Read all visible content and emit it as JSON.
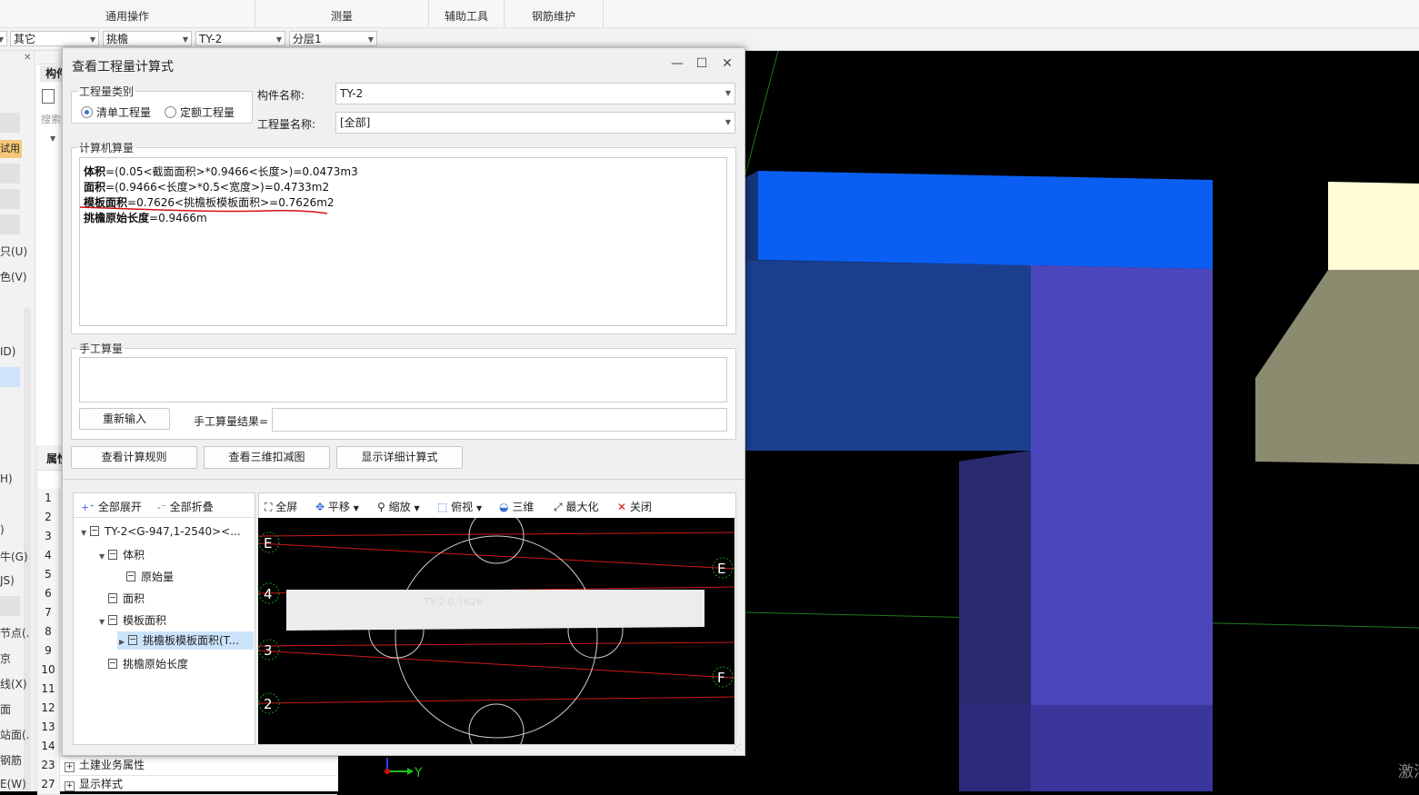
{
  "ribbon": {
    "groups": [
      "通用操作",
      "测量",
      "辅助工具",
      "钢筋维护"
    ]
  },
  "filterbar": {
    "combos": [
      {
        "value": ""
      },
      {
        "value": "其它"
      },
      {
        "value": "挑檐"
      },
      {
        "value": "TY-2"
      },
      {
        "value": "分层1"
      }
    ]
  },
  "left_panel": {
    "header_label": "构件",
    "search_placeholder": "搜索",
    "trial_badge": "试用",
    "strip_texts": [
      "只(U)",
      "色(V)",
      "ID)",
      "H)",
      ")",
      "牛(G)",
      "JS)",
      "节点(.",
      "京",
      "线(X)",
      "面",
      "站面(.",
      "钢筋",
      "E(W)"
    ],
    "prop_header": "属性",
    "prop_rows": [
      {
        "num": "1",
        "label": ""
      },
      {
        "num": "2",
        "label": ""
      },
      {
        "num": "3",
        "label": ""
      },
      {
        "num": "4",
        "label": ""
      },
      {
        "num": "5",
        "label": ""
      },
      {
        "num": "6",
        "label": ""
      },
      {
        "num": "7",
        "label": ""
      },
      {
        "num": "8",
        "label": ""
      },
      {
        "num": "9",
        "label": ""
      },
      {
        "num": "10",
        "label": ""
      },
      {
        "num": "11",
        "label": ""
      },
      {
        "num": "12",
        "label": ""
      },
      {
        "num": "13",
        "label": ""
      },
      {
        "num": "14",
        "label": ""
      },
      {
        "num": "23",
        "label": "土建业务属性"
      },
      {
        "num": "27",
        "label": "显示样式"
      }
    ]
  },
  "dialog": {
    "title": "查看工程量计算式",
    "window_buttons": {
      "minimize": "—",
      "maximize": "☐",
      "close": "✕"
    },
    "quantity_type": {
      "legend": "工程量类别",
      "options": [
        {
          "label": "清单工程量",
          "selected": true
        },
        {
          "label": "定额工程量",
          "selected": false
        }
      ]
    },
    "component_name_label": "构件名称:",
    "component_name_value": "TY-2",
    "quantity_name_label": "工程量名称:",
    "quantity_name_value": "[全部]",
    "computer_calc": {
      "legend": "计算机算量",
      "lines": [
        {
          "name": "体积",
          "expr": "=(0.05<截面面积>*0.9466<长度>)=0.0473m3"
        },
        {
          "name": "面积",
          "expr": "=(0.9466<长度>*0.5<宽度>)=0.4733m2"
        },
        {
          "name": "模板面积",
          "expr": "=0.7626<挑檐板模板面积>=0.7626m2"
        },
        {
          "name": "挑檐原始长度",
          "expr": "=0.9466m"
        }
      ]
    },
    "manual_calc": {
      "legend": "手工算量",
      "reinput_button": "重新输入",
      "result_label": "手工算量结果=",
      "result_value": ""
    },
    "buttons": {
      "view_rules": "查看计算规则",
      "view_3d_deduction": "查看三维扣减图",
      "show_detail": "显示详细计算式"
    },
    "tree_toolbar": {
      "expand_all": "全部展开",
      "collapse_all": "全部折叠"
    },
    "tree": [
      {
        "label": "TY-2<G-947,1-2540><...",
        "level": 0,
        "expanded": true
      },
      {
        "label": "体积",
        "level": 1,
        "expanded": true
      },
      {
        "label": "原始量",
        "level": 2
      },
      {
        "label": "面积",
        "level": 1
      },
      {
        "label": "模板面积",
        "level": 1,
        "expanded": true
      },
      {
        "label": "挑檐板模板面积(T...",
        "level": 2,
        "selected": true,
        "collapsed": true
      },
      {
        "label": "挑檐原始长度",
        "level": 1
      }
    ],
    "view_toolbar": {
      "fullscreen": "全屏",
      "pan": "平移",
      "zoom": "缩放",
      "top_view": "俯视",
      "three_d": "三维",
      "maximize": "最大化",
      "close": "关闭"
    },
    "view_labels": {
      "axis_markers": [
        "E",
        "E",
        "4",
        "3",
        "F",
        "2"
      ],
      "element_label": "TY-2 0.7626"
    }
  },
  "viewport": {
    "axis_label": "Y",
    "watermark": "激活"
  }
}
